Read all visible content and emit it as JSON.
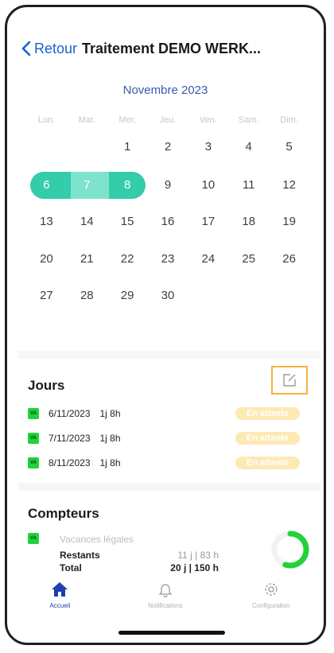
{
  "header": {
    "back_label": "Retour",
    "title": "Traitement DEMO WERK..."
  },
  "calendar": {
    "month_label": "Novembre 2023",
    "weekdays": [
      "Lun.",
      "Mar.",
      "Mer.",
      "Jeu.",
      "Ven.",
      "Sam.",
      "Dim."
    ],
    "weeks": [
      [
        "",
        "",
        "1",
        "2",
        "3",
        "4",
        "5"
      ],
      [
        "6",
        "7",
        "8",
        "9",
        "10",
        "11",
        "12"
      ],
      [
        "13",
        "14",
        "15",
        "16",
        "17",
        "18",
        "19"
      ],
      [
        "20",
        "21",
        "22",
        "23",
        "24",
        "25",
        "26"
      ],
      [
        "27",
        "28",
        "29",
        "30",
        "",
        "",
        ""
      ]
    ],
    "selected_days": [
      "6",
      "7",
      "8"
    ]
  },
  "jours": {
    "title": "Jours",
    "rows": [
      {
        "code": "VA",
        "date": "6/11/2023",
        "duration": "1j 8h",
        "status": "En attente"
      },
      {
        "code": "VA",
        "date": "7/11/2023",
        "duration": "1j 8h",
        "status": "En attente"
      },
      {
        "code": "VA",
        "date": "8/11/2023",
        "duration": "1j 8h",
        "status": "En attente"
      }
    ]
  },
  "compteurs": {
    "title": "Compteurs",
    "code": "VA",
    "label": "Vacances légales",
    "restants_label": "Restants",
    "restants_value": "11 j | 83 h",
    "total_label": "Total",
    "total_value": "20 j | 150 h",
    "gauge_fraction": 0.55
  },
  "tabs": [
    {
      "label": "Accueil",
      "icon": "home-icon",
      "active": true
    },
    {
      "label": "Notifications",
      "icon": "bell-icon",
      "active": false
    },
    {
      "label": "Configuration",
      "icon": "gear-icon",
      "active": false
    }
  ],
  "colors": {
    "accent": "#1463d1",
    "selection": "#34ccaa",
    "badge": "#fde9b4",
    "va_tag": "#20d33a",
    "gauge": "#22d33a"
  }
}
